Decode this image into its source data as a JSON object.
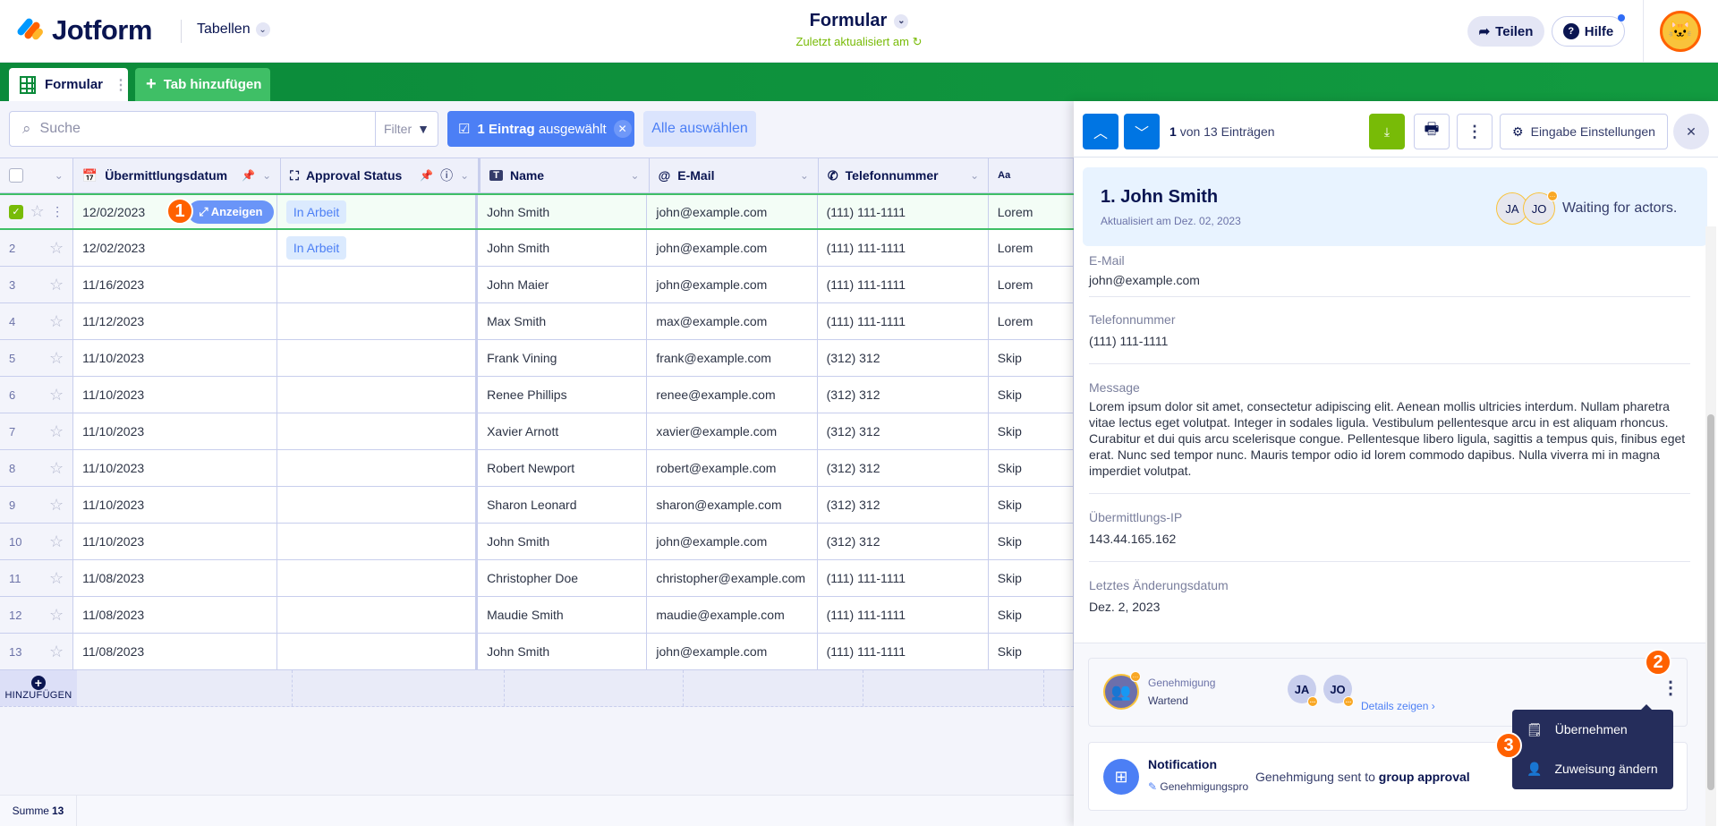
{
  "header": {
    "logo": "Jotform",
    "tables_menu": "Tabellen",
    "form_title": "Formular",
    "last_updated": "Zuletzt aktualisiert am",
    "share": "Teilen",
    "help": "Hilfe"
  },
  "tabs": {
    "active": "Formular",
    "add": "Tab hinzufügen"
  },
  "toolbar": {
    "search_placeholder": "Suche",
    "filter": "Filter",
    "selected_count": "1 Eintrag",
    "selected_suffix": "ausgewählt",
    "select_all": "Alle auswählen"
  },
  "columns": [
    "Übermittlungsdatum",
    "Approval Status",
    "Name",
    "E-Mail",
    "Telefonnummer",
    "Aa"
  ],
  "rows": [
    {
      "n": "1",
      "date": "12/02/2023",
      "status": "In Arbeit",
      "name": "John Smith",
      "email": "john@example.com",
      "phone": "(111) 111-1111",
      "text": "Lorem",
      "selected": true
    },
    {
      "n": "2",
      "date": "12/02/2023",
      "status": "In Arbeit",
      "name": "John Smith",
      "email": "john@example.com",
      "phone": "(111) 111-1111",
      "text": "Lorem"
    },
    {
      "n": "3",
      "date": "11/16/2023",
      "status": "",
      "name": "John Maier",
      "email": "john@example.com",
      "phone": "(111) 111-1111",
      "text": "Lorem"
    },
    {
      "n": "4",
      "date": "11/12/2023",
      "status": "",
      "name": "Max Smith",
      "email": "max@example.com",
      "phone": "(111) 111-1111",
      "text": "Lorem"
    },
    {
      "n": "5",
      "date": "11/10/2023",
      "status": "",
      "name": "Frank Vining",
      "email": "frank@example.com",
      "phone": "(312) 312",
      "text": "Skip"
    },
    {
      "n": "6",
      "date": "11/10/2023",
      "status": "",
      "name": "Renee Phillips",
      "email": "renee@example.com",
      "phone": "(312) 312",
      "text": "Skip"
    },
    {
      "n": "7",
      "date": "11/10/2023",
      "status": "",
      "name": "Xavier Arnott",
      "email": "xavier@example.com",
      "phone": "(312) 312",
      "text": "Skip"
    },
    {
      "n": "8",
      "date": "11/10/2023",
      "status": "",
      "name": "Robert Newport",
      "email": "robert@example.com",
      "phone": "(312) 312",
      "text": "Skip"
    },
    {
      "n": "9",
      "date": "11/10/2023",
      "status": "",
      "name": "Sharon Leonard",
      "email": "sharon@example.com",
      "phone": "(312) 312",
      "text": "Skip"
    },
    {
      "n": "10",
      "date": "11/10/2023",
      "status": "",
      "name": "John Smith",
      "email": "john@example.com",
      "phone": "(312) 312",
      "text": "Skip"
    },
    {
      "n": "11",
      "date": "11/08/2023",
      "status": "",
      "name": "Christopher Doe",
      "email": "christopher@example.com",
      "phone": "(111) 111-1111",
      "text": "Skip"
    },
    {
      "n": "12",
      "date": "11/08/2023",
      "status": "",
      "name": "Maudie Smith",
      "email": "maudie@example.com",
      "phone": "(111) 111-1111",
      "text": "Skip"
    },
    {
      "n": "13",
      "date": "11/08/2023",
      "status": "",
      "name": "John Smith",
      "email": "john@example.com",
      "phone": "(111) 111-1111",
      "text": "Skip"
    }
  ],
  "view_button": "Anzeigen",
  "add_row": "HINZUFÜGEN",
  "footer": {
    "sum_label": "Summe",
    "sum_value": "13"
  },
  "annotations": {
    "b1": "1",
    "b2": "2",
    "b3": "3"
  },
  "panel": {
    "position": "1",
    "position_text": "von 13 Einträgen",
    "settings": "Eingabe Einstellungen",
    "entry_title": "1. John Smith",
    "entry_updated": "Aktualisiert am Dez. 02, 2023",
    "actors": [
      "JA",
      "JO"
    ],
    "actors_status": "Waiting for actors.",
    "fields": [
      {
        "label": "E-Mail",
        "value": "john@example.com"
      },
      {
        "label": "Telefonnummer",
        "value": "(111) 111-1111"
      },
      {
        "label": "Message",
        "value": "Lorem ipsum dolor sit amet, consectetur adipiscing elit. Aenean mollis ultricies interdum. Nullam pharetra vitae lectus eget volutpat. Integer in sodales ligula. Vestibulum pellentesque arcu in est aliquam rhoncus. Curabitur et dui quis arcu scelerisque congue. Pellentesque libero ligula, sagittis a tempus quis, finibus eget erat. Nunc sed tempor nunc. Mauris tempor odio id lorem commodo dapibus. Nulla viverra mi in magna imperdiet volutpat."
      },
      {
        "label": "Übermittlungs-IP",
        "value": "143.44.165.162"
      },
      {
        "label": "Letztes Änderungsdatum",
        "value": "Dez. 2, 2023"
      }
    ],
    "approval": {
      "title": "Genehmigung",
      "status": "Wartend",
      "assignees": [
        "JA",
        "JO"
      ],
      "details": "Details zeigen ›"
    },
    "menu": [
      "Übernehmen",
      "Zuweisung ändern"
    ],
    "notification": {
      "title": "Notification",
      "subtitle": "Genehmigungsproz",
      "text_prefix": "Genehmigung sent to",
      "text_bold": "group approval"
    }
  },
  "colors": {
    "brand_green": "#0b8a3a",
    "accent_blue": "#0075e3",
    "badge_orange": "#ff6100",
    "download_green": "#78bb07"
  }
}
